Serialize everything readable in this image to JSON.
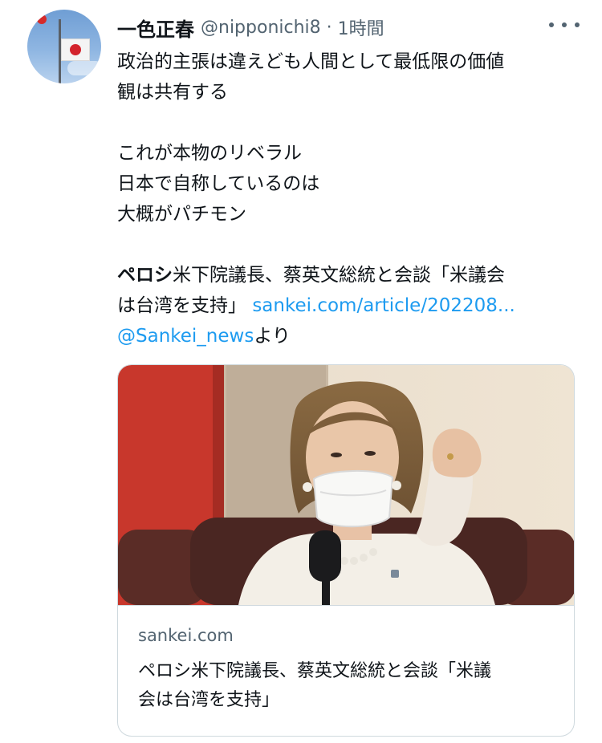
{
  "author": {
    "name": "一色正春",
    "handle": "@nipponichi8",
    "separator": "·",
    "time": "1時間"
  },
  "icons": {
    "avatar": "flag-at-half-mast-avatar",
    "more": "more-options-icon"
  },
  "tweet": {
    "lines": [
      "政治的主張は違えども人間として最低限の価値",
      "観は共有する",
      "",
      "これが本物のリベラル",
      "日本で自称しているのは",
      "大概がパチモン"
    ],
    "share_bold": "ペロシ",
    "share_line1_rest": "米下院議長、蔡英文総統と会談「米議会",
    "share_line2_text": "は台湾を支持」",
    "share_link": "sankei.com/article/202208...",
    "mention": "@Sankei_news",
    "mention_suffix": "より"
  },
  "card": {
    "domain": "sankei.com",
    "title_lines": [
      "ペロシ米下院議長、蔡英文総統と会談「米議",
      "会は台湾を支持」"
    ]
  },
  "colors": {
    "link": "#1d9bf0",
    "secondary_text": "#536471",
    "primary_text": "#0f1419",
    "border": "#cfd9de"
  }
}
